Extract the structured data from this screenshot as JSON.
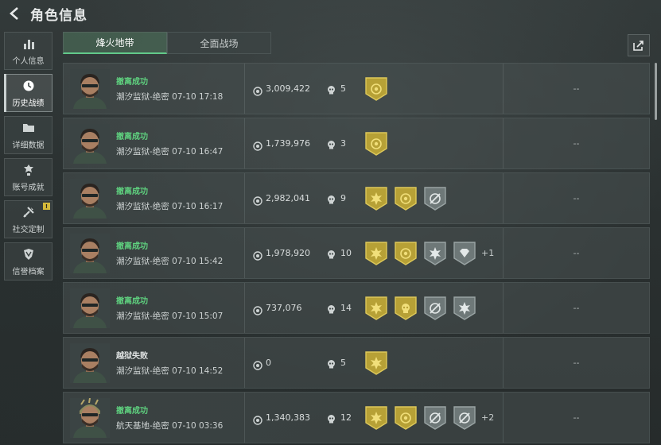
{
  "header": {
    "title": "角色信息"
  },
  "sidebar": {
    "items": [
      {
        "label": "个人信息",
        "icon": "bar-chart-icon"
      },
      {
        "label": "历史战绩",
        "icon": "clock-icon"
      },
      {
        "label": "详细数据",
        "icon": "folder-icon"
      },
      {
        "label": "账号成就",
        "icon": "trophy-icon"
      },
      {
        "label": "社交定制",
        "icon": "wrench-icon"
      },
      {
        "label": "信誉档案",
        "icon": "shield-icon"
      }
    ],
    "active_index": 1,
    "notice_badge": "!"
  },
  "tabs": [
    {
      "label": "烽火地带"
    },
    {
      "label": "全面战场"
    }
  ],
  "rows": [
    {
      "result": "撤离成功",
      "success": true,
      "map": "潮汐监狱-绝密",
      "time": "07-10 17:18",
      "money": "3,009,422",
      "kills": "5",
      "medals": [
        "gold-shield"
      ],
      "extra": "",
      "score": "--"
    },
    {
      "result": "撤离成功",
      "success": true,
      "map": "潮汐监狱-绝密",
      "time": "07-10 16:47",
      "money": "1,739,976",
      "kills": "3",
      "medals": [
        "gold-shield"
      ],
      "extra": "",
      "score": "--"
    },
    {
      "result": "撤离成功",
      "success": true,
      "map": "潮汐监狱-绝密",
      "time": "07-10 16:17",
      "money": "2,982,041",
      "kills": "9",
      "medals": [
        "gold-star",
        "gold-shield",
        "gray-cross"
      ],
      "extra": "",
      "score": "--"
    },
    {
      "result": "撤离成功",
      "success": true,
      "map": "潮汐监狱-绝密",
      "time": "07-10 15:42",
      "money": "1,978,920",
      "kills": "10",
      "medals": [
        "gold-star",
        "gold-shield",
        "gray-burst",
        "gray-gem"
      ],
      "extra": "+1",
      "score": "--"
    },
    {
      "result": "撤离成功",
      "success": true,
      "map": "潮汐监狱-绝密",
      "time": "07-10 15:07",
      "money": "737,076",
      "kills": "14",
      "medals": [
        "gold-star",
        "gold-skull",
        "gray-cross",
        "gray-burst"
      ],
      "extra": "",
      "score": "--"
    },
    {
      "result": "越狱失败",
      "success": false,
      "map": "潮汐监狱-绝密",
      "time": "07-10 14:52",
      "money": "0",
      "kills": "5",
      "medals": [
        "gold-star"
      ],
      "extra": "",
      "score": "--"
    },
    {
      "result": "撤离成功",
      "success": true,
      "map": "航天基地-绝密",
      "time": "07-10 03:36",
      "money": "1,340,383",
      "kills": "12",
      "medals": [
        "gold-star",
        "gold-shield",
        "gray-cross",
        "gray-cross"
      ],
      "extra": "+2",
      "score": "--"
    }
  ],
  "colors": {
    "success": "#5fd17f",
    "gold": "#c8b34a",
    "accent_tab": "#62c98a"
  }
}
